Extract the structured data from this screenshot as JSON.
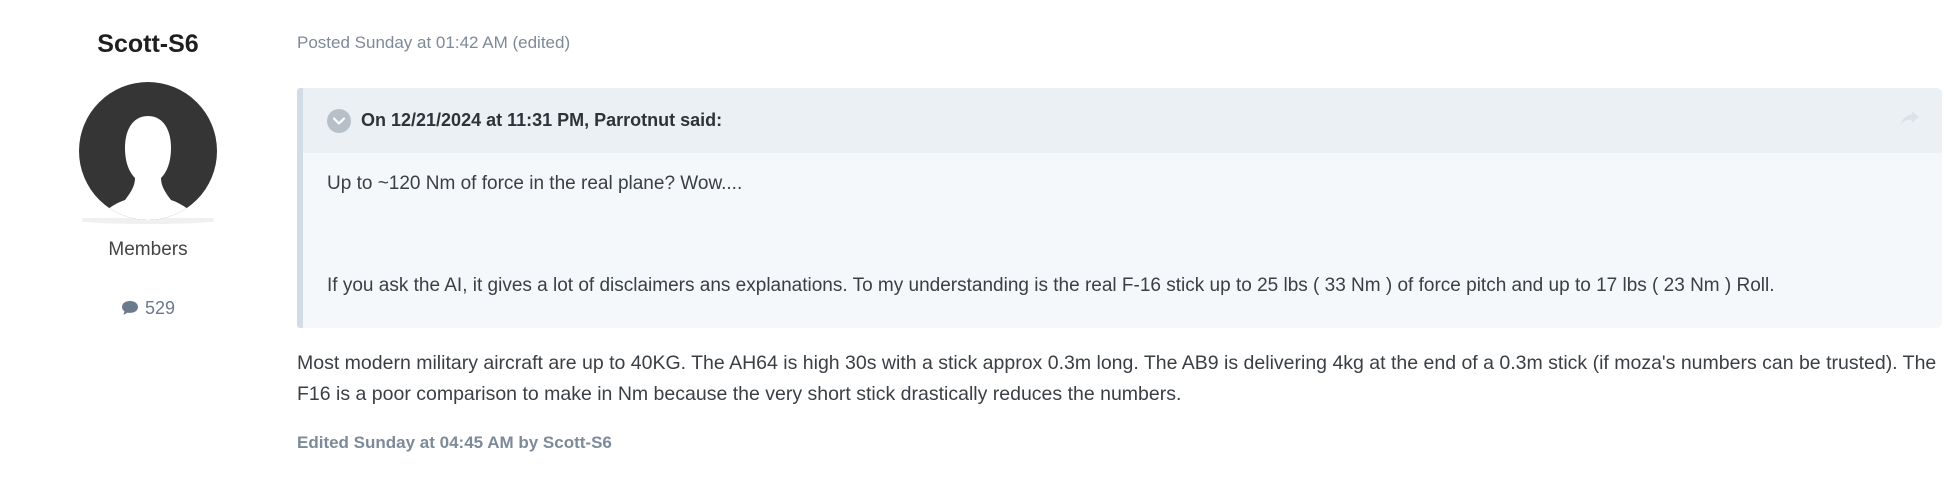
{
  "author": {
    "name": "Scott-S6",
    "group": "Members",
    "post_count": "529"
  },
  "post": {
    "meta": "Posted Sunday at 01:42 AM (edited)",
    "quote": {
      "citation": "On 12/21/2024 at 11:31 PM, Parrotnut said:",
      "line1": "Up to ~120 Nm of force in the real plane? Wow....",
      "line2": "If you ask the AI, it gives a lot of disclaimers ans explanations. To my understanding is the real F-16 stick up to 25 lbs ( 33 Nm ) of force pitch and up to 17 lbs ( 23 Nm ) Roll."
    },
    "body": "Most modern military aircraft are up to 40KG. The AH64 is high 30s with a stick approx 0.3m long. The AB9 is delivering 4kg at the end of a 0.3m stick (if moza's numbers can be trusted). The F16 is a poor comparison to make in Nm because the very short stick drastically reduces the numbers.",
    "edited": "Edited Sunday at 04:45 AM by Scott-S6"
  },
  "icons": {
    "avatar": "default-avatar-silhouette",
    "posts": "comment-icon",
    "toggle": "chevron-down-icon",
    "share": "share-arrow-icon"
  },
  "colors": {
    "meta_text": "#7d8a99",
    "quote_bg": "#f5f8fb",
    "quote_header_bg": "#ebf0f4",
    "quote_border": "#d2dce6"
  }
}
